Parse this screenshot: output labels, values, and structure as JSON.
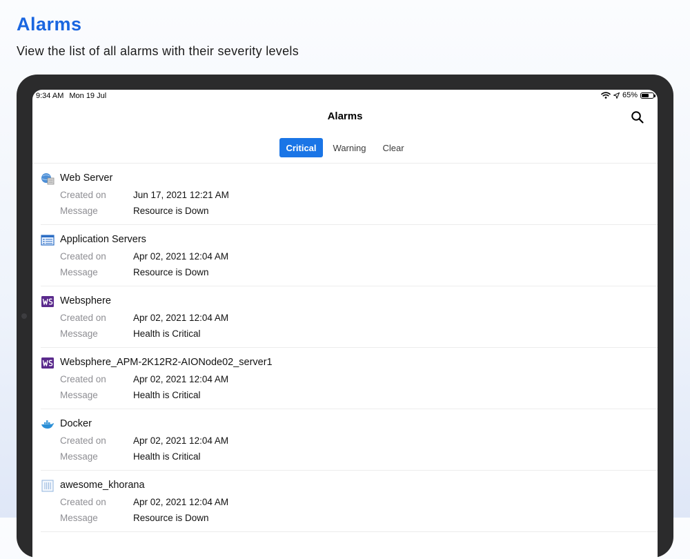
{
  "promo": {
    "title": "Alarms",
    "subtitle": "View the list of all alarms with their severity levels"
  },
  "status_bar": {
    "time": "9:34 AM",
    "date": "Mon 19 Jul",
    "battery": "65%",
    "battery_level": 0.65
  },
  "nav": {
    "title": "Alarms"
  },
  "tabs": [
    {
      "label": "Critical",
      "selected": true
    },
    {
      "label": "Warning",
      "selected": false
    },
    {
      "label": "Clear",
      "selected": false
    }
  ],
  "labels": {
    "created_on": "Created on",
    "message": "Message"
  },
  "alarms": [
    {
      "name": "Web Server",
      "icon": "web-server-icon",
      "created_on": "Jun 17, 2021 12:21 AM",
      "message": "Resource is Down"
    },
    {
      "name": "Application Servers",
      "icon": "application-servers-icon",
      "created_on": "Apr 02, 2021 12:04 AM",
      "message": "Resource is Down"
    },
    {
      "name": "Websphere",
      "icon": "websphere-icon",
      "created_on": "Apr 02, 2021 12:04 AM",
      "message": "Health is Critical"
    },
    {
      "name": "Websphere_APM-2K12R2-AIONode02_server1",
      "icon": "websphere-icon",
      "created_on": "Apr 02, 2021 12:04 AM",
      "message": "Health is Critical"
    },
    {
      "name": "Docker",
      "icon": "docker-icon",
      "created_on": "Apr 02, 2021 12:04 AM",
      "message": "Health is Critical"
    },
    {
      "name": "awesome_khorana",
      "icon": "container-icon",
      "created_on": "Apr 02, 2021 12:04 AM",
      "message": "Resource is Down"
    }
  ],
  "colors": {
    "accent": "#1a75e6",
    "promo_title": "#1a66e0",
    "bezel": "#2b2b2c"
  }
}
